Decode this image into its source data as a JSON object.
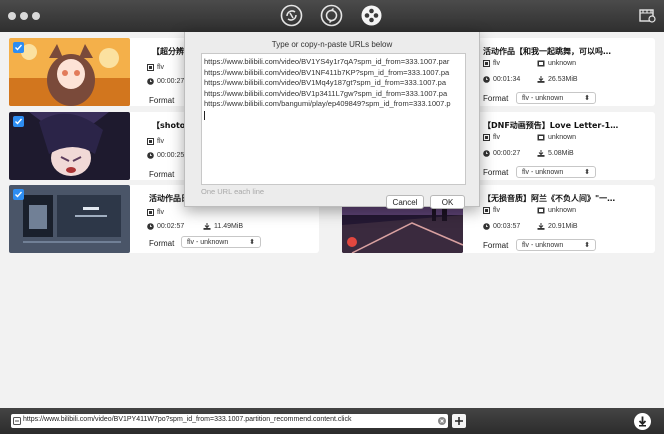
{
  "toolbar": {
    "icons": [
      "download-link-icon",
      "convert-icon",
      "film-reel-icon",
      "video-settings-icon"
    ]
  },
  "items": [
    {
      "title": "【超分辨率",
      "format": "flv",
      "duration": "00:00:27",
      "size": "",
      "format_label": "Format",
      "format_value": "flv - unknown"
    },
    {
      "title": "【shoto】",
      "format": "flv",
      "duration": "00:00:25",
      "size": "",
      "format_label": "Format",
      "format_value": "flv - unknown"
    },
    {
      "title": "活动作品日",
      "format": "flv",
      "duration": "00:02:57",
      "size": "11.49MiB",
      "format_label": "Format",
      "format_value": "flv - unknown"
    },
    {
      "title": "活动作品【和我一起跳舞，可以吗…",
      "format": "flv",
      "format2": "unknown",
      "duration": "00:01:34",
      "size": "26.53MiB",
      "format_label": "Format",
      "format_value": "flv - unknown"
    },
    {
      "title": "【DNF动画预告】Love Letter-1…",
      "format": "flv",
      "format2": "unknown",
      "duration": "00:00:27",
      "size": "5.08MiB",
      "format_label": "Format",
      "format_value": "flv - unknown"
    },
    {
      "title": "【无损音质】阿兰《不负人间》\"一…",
      "format": "flv",
      "format2": "unknown",
      "duration": "00:03:57",
      "size": "20.91MiB",
      "format_label": "Format",
      "format_value": "flv - unknown"
    }
  ],
  "dialog": {
    "title": "Type or copy-n-paste URLs below",
    "lines": [
      "https://www.bilibili.com/video/BV1YS4y1r7qA?spm_id_from=333.1007.par",
      "https://www.bilibili.com/video/BV1NF411b7KP?spm_id_from=333.1007.pa",
      "https://www.bilibili.com/video/BV1Mq4y187gt?spm_id_from=333.1007.pa",
      "https://www.bilibili.com/video/BV1p3411L7gw?spm_id_from=333.1007.pa",
      "https://www.bilibili.com/bangumi/play/ep409849?spm_id_from=333.1007.p"
    ],
    "hint": "One URL each line",
    "cancel_label": "Cancel",
    "ok_label": "OK"
  },
  "bottom": {
    "url_value": "https://www.bilibili.com/video/BV1PY411W7po?spm_id_from=333.1007.partition_recommend.content.click"
  },
  "colors": {
    "accent": "#2d8df2",
    "titlebar": "#3a3a3a",
    "background": "#f2f2f2"
  }
}
